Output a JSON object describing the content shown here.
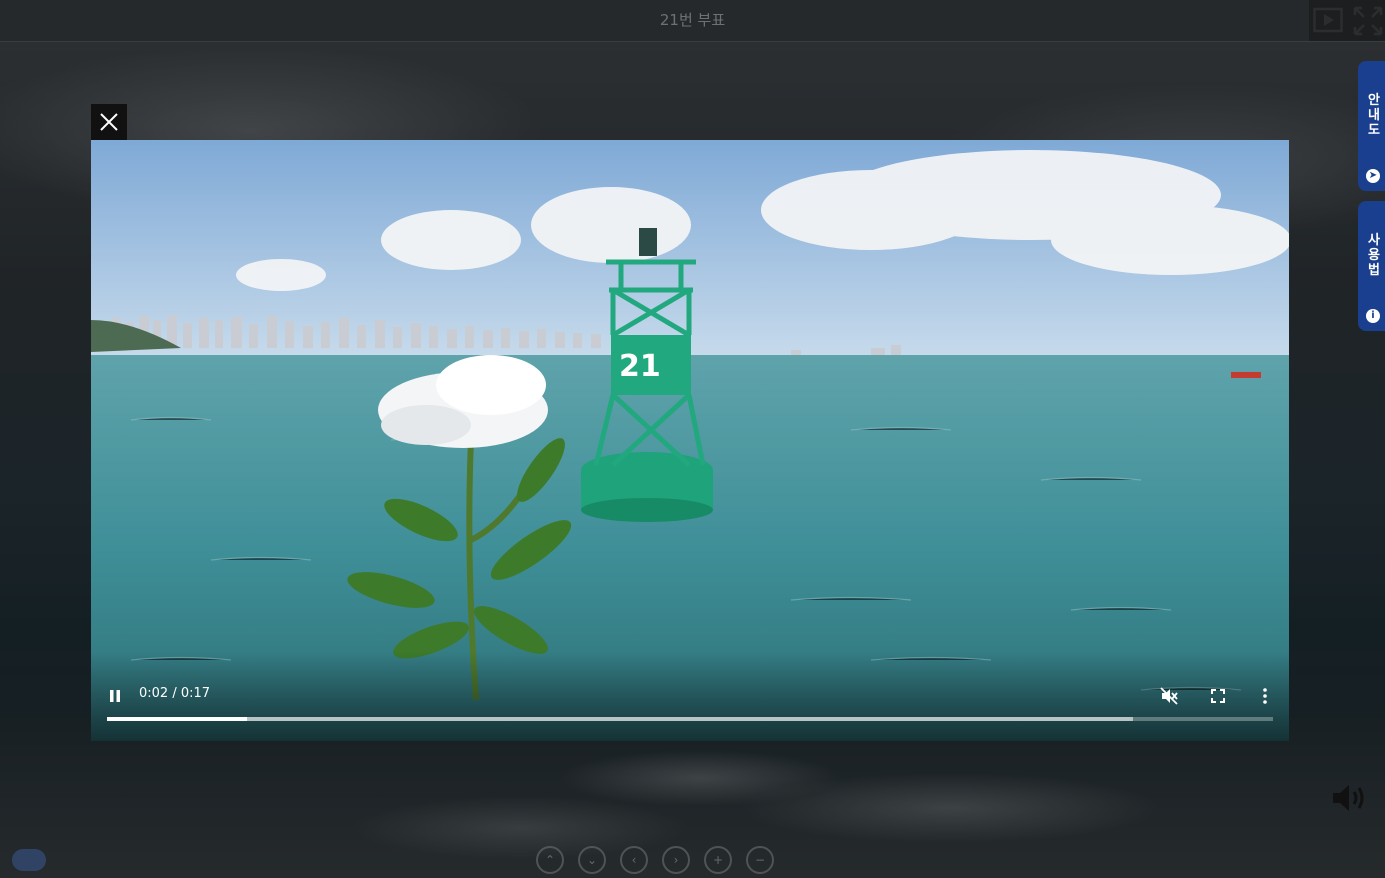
{
  "header": {
    "title": "21번 부표"
  },
  "top_icons": {
    "autoplay_icon": "play-box-icon",
    "fullscreen_icon": "fullscreen-icon"
  },
  "side_tabs": [
    {
      "label": "안내도",
      "icon": "compass-icon"
    },
    {
      "label": "사용법",
      "icon": "info-icon"
    }
  ],
  "video": {
    "buoy_number": "21",
    "time_display": "0:02 / 0:17",
    "played_fraction": 0.12,
    "buffered_fraction": 0.88,
    "state": "playing",
    "muted": true
  },
  "colors": {
    "side_tab": "#1b3f8f",
    "buoy": "#1fa37a",
    "sea": "#3f8f98",
    "sky": "#8fb8de"
  }
}
